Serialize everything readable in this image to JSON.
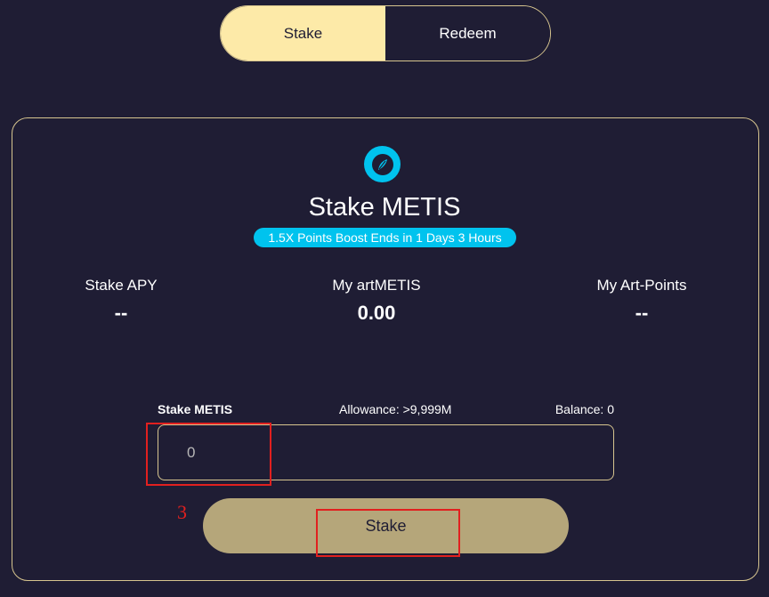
{
  "toggle": {
    "stake_label": "Stake",
    "redeem_label": "Redeem"
  },
  "card": {
    "logo_icon": "metis-leaf-icon",
    "title": "Stake METIS",
    "boost_badge": "1.5X Points Boost Ends in 1 Days 3 Hours",
    "stats": [
      {
        "label": "Stake APY",
        "value": "--"
      },
      {
        "label": "My artMETIS",
        "value": "0.00"
      },
      {
        "label": "My Art-Points",
        "value": "--"
      }
    ],
    "input": {
      "label": "Stake METIS",
      "allowance": "Allowance: >9,999M",
      "balance": "Balance: 0",
      "placeholder": "0"
    },
    "stake_button": "Stake"
  },
  "annotation": {
    "step_number": "3"
  },
  "colors": {
    "background": "#1f1d34",
    "accent_gold": "#d7c58f",
    "active_tab": "#fdeaa8",
    "button": "#b5a67a",
    "badge": "#00c3ee",
    "highlight": "#e1201f"
  }
}
